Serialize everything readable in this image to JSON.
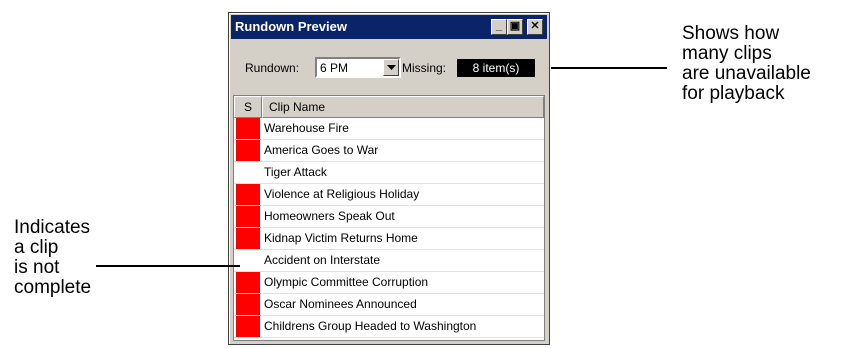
{
  "window": {
    "title": "Rundown Preview",
    "controls": {
      "minimize": "_",
      "maximize": "▣",
      "close": "✕"
    },
    "rundown_label": "Rundown:",
    "rundown_value": "6 PM",
    "missing_label": "Missing:",
    "missing_value": "8 item(s)"
  },
  "table": {
    "columns": [
      "S",
      "Clip Name"
    ],
    "rows": [
      {
        "name": "Warehouse Fire",
        "status": "missing"
      },
      {
        "name": "America Goes to War",
        "status": "missing"
      },
      {
        "name": "Tiger Attack",
        "status": "ok"
      },
      {
        "name": "Violence at Religious Holiday",
        "status": "missing"
      },
      {
        "name": "Homeowners Speak Out",
        "status": "missing"
      },
      {
        "name": "Kidnap Victim Returns Home",
        "status": "missing"
      },
      {
        "name": "Accident on Interstate",
        "status": "ok"
      },
      {
        "name": "Olympic Committee Corruption",
        "status": "missing"
      },
      {
        "name": "Oscar Nominees Announced",
        "status": "missing"
      },
      {
        "name": "Childrens Group Headed to Washington",
        "status": "missing"
      }
    ]
  },
  "callouts": {
    "right": "Shows how\nmany clips\nare unavailable\nfor playback",
    "left": "Indicates\na clip\nis not\ncomplete"
  },
  "colors": {
    "missing": "#ff0000",
    "titlebar": "#0a246a"
  }
}
